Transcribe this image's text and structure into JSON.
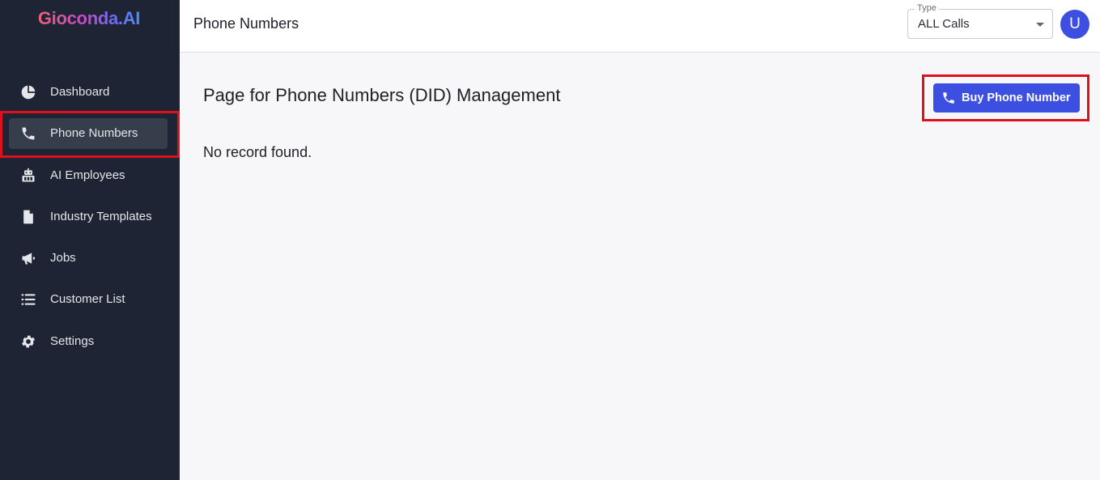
{
  "logo": {
    "text": "Gioconda.AI"
  },
  "sidebar": {
    "items": [
      {
        "label": "Dashboard",
        "icon": "pie-chart-icon"
      },
      {
        "label": "Phone Numbers",
        "icon": "phone-icon",
        "active": true
      },
      {
        "label": "AI Employees",
        "icon": "robot-icon"
      },
      {
        "label": "Industry Templates",
        "icon": "file-icon"
      },
      {
        "label": "Jobs",
        "icon": "megaphone-icon"
      },
      {
        "label": "Customer List",
        "icon": "list-icon"
      },
      {
        "label": "Settings",
        "icon": "gear-icon"
      }
    ]
  },
  "header": {
    "title": "Phone Numbers",
    "type_select": {
      "legend": "Type",
      "value": "ALL Calls"
    },
    "avatar_initial": "U"
  },
  "main": {
    "title": "Page for Phone Numbers (DID) Management",
    "empty_message": "No record found.",
    "buy_button_label": "Buy Phone Number"
  },
  "colors": {
    "sidebar_bg": "#1e2433",
    "accent": "#3d4fe0",
    "highlight": "#e0101a",
    "page_bg": "#f7f7f9"
  }
}
